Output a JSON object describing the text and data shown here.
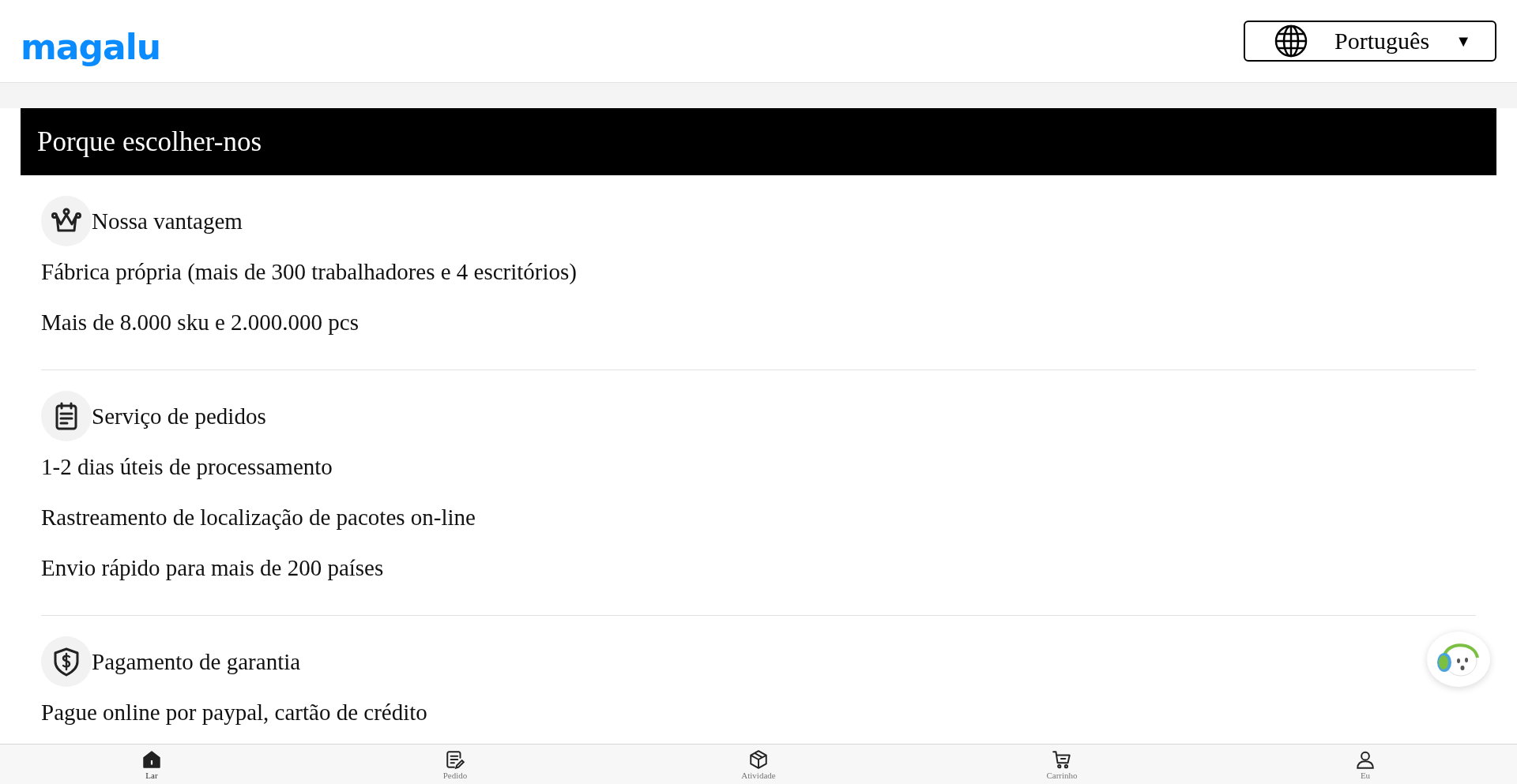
{
  "header": {
    "logo": "magalu",
    "language": {
      "label": "Português",
      "caret": "▼"
    }
  },
  "banner": {
    "title": "Porque escolher-nos"
  },
  "sections": [
    {
      "kind": "crown",
      "title": "Nossa vantagem",
      "lines": [
        "Fábrica própria (mais de 300 trabalhadores e 4 escritórios)",
        "Mais de 8.000 sku e 2.000.000 pcs"
      ]
    },
    {
      "kind": "clipboard",
      "title": "Serviço de pedidos",
      "lines": [
        "1-2 dias úteis de processamento",
        "Rastreamento de localização de pacotes on-line",
        "Envio rápido para mais de 200 países"
      ]
    },
    {
      "kind": "shield",
      "title": "Pagamento de garantia",
      "lines": [
        "Pague online por paypal, cartão de crédito"
      ]
    }
  ],
  "bottom_nav": [
    {
      "kind": "home",
      "label": "Lar",
      "selected": true
    },
    {
      "kind": "order",
      "label": "Pedido",
      "selected": false
    },
    {
      "kind": "box",
      "label": "Atividade",
      "selected": false
    },
    {
      "kind": "cart",
      "label": "Carrinho",
      "selected": false
    },
    {
      "kind": "user",
      "label": "Eu",
      "selected": false
    }
  ]
}
